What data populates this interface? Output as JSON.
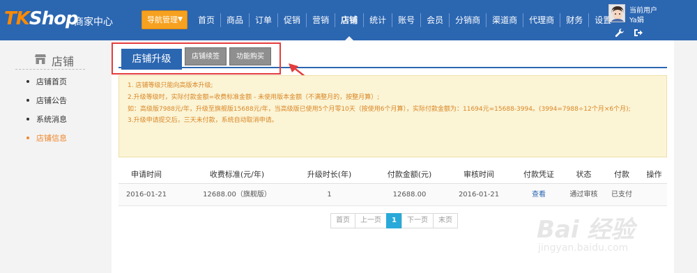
{
  "header": {
    "logo_tk": "TK",
    "logo_shop": "Shop",
    "merchant_center": "商家中心",
    "nav_button": "导航管理",
    "nav": [
      "首页",
      "商品",
      "订单",
      "促销",
      "营销",
      "店铺",
      "统计",
      "账号",
      "会员",
      "分销商",
      "渠道商",
      "代理商",
      "财务",
      "设置"
    ],
    "active_nav": "店铺",
    "user_label": "当前用户",
    "user_name": "Ya娟",
    "colors": {
      "bar": "#2b66b1",
      "accent": "#f7a120"
    }
  },
  "sidebar": {
    "title": "店铺",
    "items": [
      "店铺首页",
      "店铺公告",
      "系统消息",
      "店铺信息"
    ],
    "active_item": "店铺信息"
  },
  "tabs": {
    "active": "店铺升级",
    "others": [
      "店铺续签",
      "功能购买"
    ]
  },
  "notice": [
    "1. 店铺等级只能向高版本升级;",
    "2.升级等级时，实际付款金额=收费标准金额 - 未使用版本金额（不满整月的，按整月算）;",
    "如：高级版7988元/年，升级至旗舰版15688元/年，当高级版已使用5个月零10天（按使用6个月算），实际付款金额为：11694元=15688-3994。(3994=7988÷12个月×6个月);",
    "3.升级申请提交后，三天未付款，系统自动取消申请。"
  ],
  "table": {
    "headers": [
      "申请时间",
      "收费标准(元/年)",
      "升级时长(年)",
      "付款金额(元)",
      "审核时间",
      "付款凭证",
      "状态",
      "付款",
      "操作"
    ],
    "rows": [
      [
        "2016-01-21",
        "12688.00（旗舰版）",
        "1",
        "12688.00",
        "2016-01-21",
        "查看",
        "通过审核",
        "已支付",
        ""
      ]
    ]
  },
  "pager": [
    "首页",
    "上一页",
    "1",
    "下一页",
    "末页"
  ],
  "watermark": {
    "word": "Bai 经验",
    "url": "jingyan.baidu.com"
  }
}
